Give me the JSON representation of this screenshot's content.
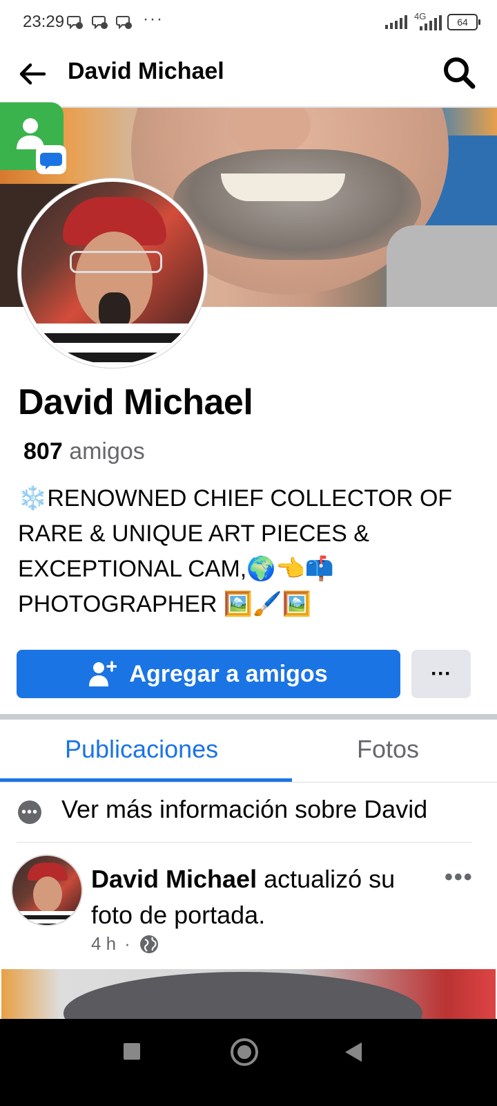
{
  "status_bar": {
    "time": "23:29",
    "more": "···",
    "network": "4G",
    "battery": "64"
  },
  "header": {
    "title": "David Michael"
  },
  "profile": {
    "name": "David Michael",
    "friends_count": "807",
    "friends_label": "amigos",
    "bio": "❄️RENOWNED CHIEF COLLECTOR OF RARE & UNIQUE ART PIECES & EXCEPTIONAL CAM,🌍👈📫 PHOTOGRAPHER 🖼️🖌️🖼️"
  },
  "actions": {
    "add_friend_label": "Agregar a amigos",
    "more_label": "···"
  },
  "tabs": [
    {
      "label": "Publicaciones",
      "active": true
    },
    {
      "label": "Fotos",
      "active": false
    }
  ],
  "more_info": {
    "text": "Ver más información sobre David"
  },
  "post": {
    "author": "David Michael",
    "action_text": " actualizó su foto de portada.",
    "time": "4 h",
    "separator": "·",
    "menu": "•••"
  },
  "colors": {
    "accent": "#1b74e4",
    "secondary_text": "#65676b",
    "button_gray": "#e4e6eb"
  }
}
